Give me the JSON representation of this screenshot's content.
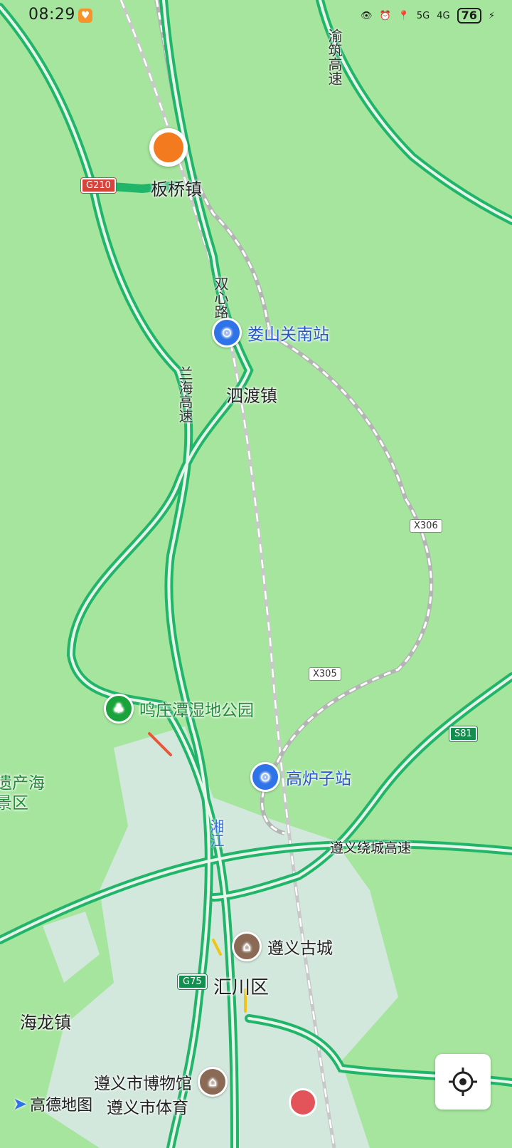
{
  "status_bar": {
    "time": "08:29",
    "network_1": "5G",
    "network_2": "4G",
    "battery": "76"
  },
  "map": {
    "towns": {
      "banqiao": "板桥镇",
      "sidu": "泗渡镇",
      "hailong": "海龙镇",
      "huichuan": "汇川区",
      "heritage_partial": "遗产海景区"
    },
    "roads": {
      "shuangxin": "双心路",
      "lanhai": "兰海高速",
      "yuzhu": "渝筑高速",
      "zunyi_ring": "遵义绕城高速",
      "xiangjiang": "湘江"
    },
    "shields": {
      "g210": "G210",
      "x306": "X306",
      "x305": "X305",
      "s81": "S81",
      "g75": "G75"
    },
    "pois": {
      "loushanguan": "娄山关南站",
      "gaoluzi": "高炉子站",
      "mingzhuangtan": "鸣庄潭湿地公园",
      "zunyi_gucheng": "遵义古城",
      "museum": "遵义市博物馆",
      "sports": "遵义市体育"
    },
    "logo_text": "高德地图",
    "colors": {
      "land": "#a6e59e",
      "highway": "#21b56a",
      "urban": "#dfe9ec"
    }
  }
}
